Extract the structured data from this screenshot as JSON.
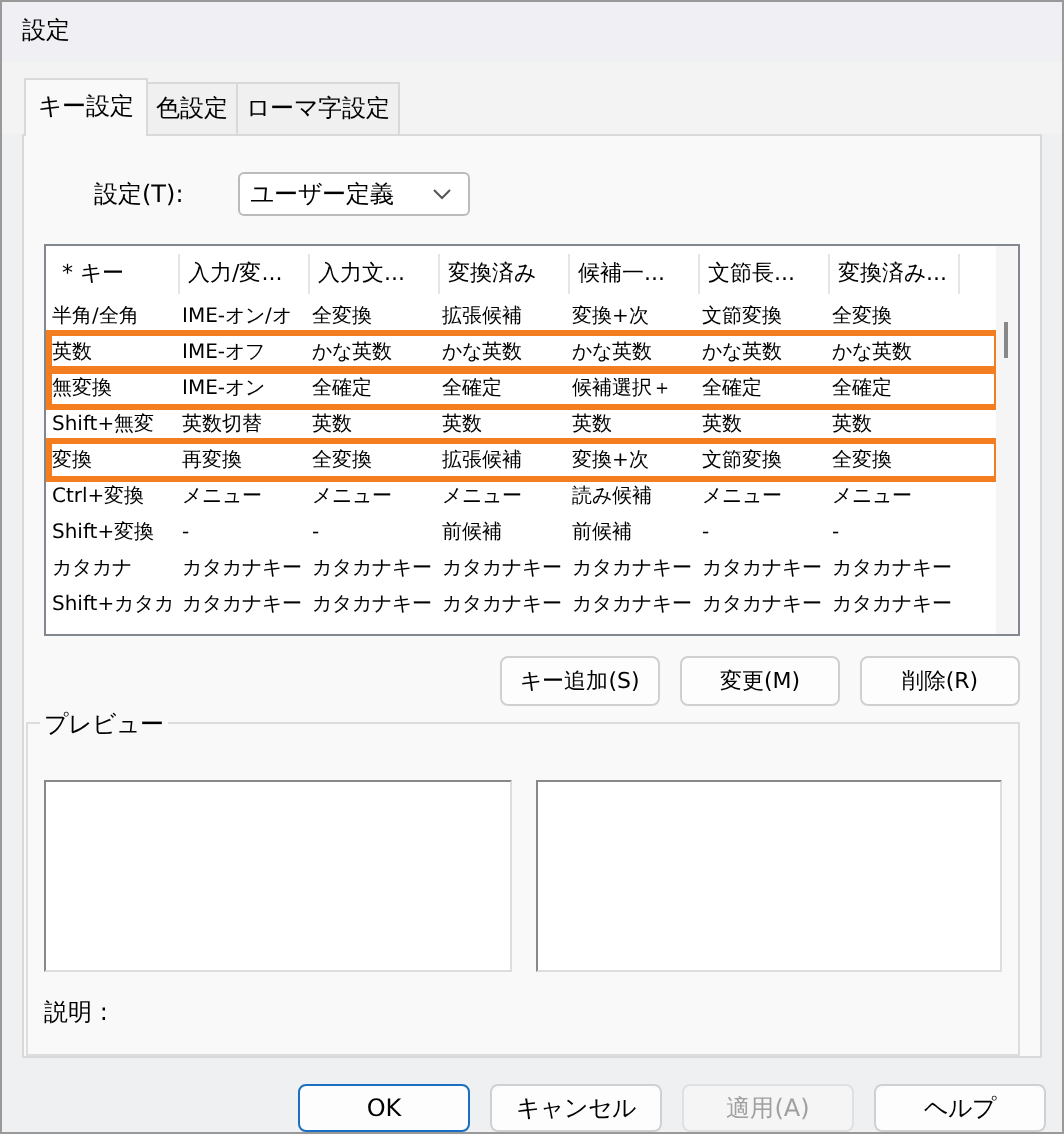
{
  "window": {
    "title": "設定"
  },
  "tabs": [
    {
      "label": "キー設定",
      "selected": true
    },
    {
      "label": "色設定",
      "selected": false
    },
    {
      "label": "ローマ字設定",
      "selected": false
    }
  ],
  "setting": {
    "label": "設定(T):",
    "value": "ユーザー定義"
  },
  "table": {
    "columns": [
      "* キー",
      "入力/変...",
      "入力文...",
      "変換済み",
      "候補一...",
      "文節長...",
      "変換済み..."
    ],
    "rows": [
      {
        "cells": [
          "半角/全角",
          "IME-オン/オ",
          "全変換",
          "拡張候補",
          "変換+次",
          "文節変換",
          "全変換"
        ],
        "highlighted": false
      },
      {
        "cells": [
          "英数",
          "IME-オフ",
          "かな英数",
          "かな英数",
          "かな英数",
          "かな英数",
          "かな英数"
        ],
        "highlighted": true
      },
      {
        "cells": [
          "無変換",
          "IME-オン",
          "全確定",
          "全確定",
          "候補選択＋",
          "全確定",
          "全確定"
        ],
        "highlighted": true
      },
      {
        "cells": [
          "Shift+無変",
          "英数切替",
          "英数",
          "英数",
          "英数",
          "英数",
          "英数"
        ],
        "highlighted": false
      },
      {
        "cells": [
          "変換",
          "再変換",
          "全変換",
          "拡張候補",
          "変換+次",
          "文節変換",
          "全変換"
        ],
        "highlighted": true
      },
      {
        "cells": [
          "Ctrl+変換",
          "メニュー",
          "メニュー",
          "メニュー",
          "読み候補",
          "メニュー",
          "メニュー"
        ],
        "highlighted": false
      },
      {
        "cells": [
          "Shift+変換",
          "-",
          "-",
          "前候補",
          "前候補",
          "-",
          "-"
        ],
        "highlighted": false
      },
      {
        "cells": [
          "カタカナ",
          "カタカナキー",
          "カタカナキー",
          "カタカナキー",
          "カタカナキー",
          "カタカナキー",
          "カタカナキー"
        ],
        "highlighted": false
      },
      {
        "cells": [
          "Shift+カタカ",
          "カタカナキー",
          "カタカナキー",
          "カタカナキー",
          "カタカナキー",
          "カタカナキー",
          "カタカナキー"
        ],
        "highlighted": false
      }
    ]
  },
  "table_buttons": [
    "キー追加(S)",
    "変更(M)",
    "削除(R)"
  ],
  "preview": {
    "title": "プレビュー",
    "description_label": "説明 :"
  },
  "dialog_buttons": [
    {
      "label": "OK",
      "disabled": false
    },
    {
      "label": "キャンセル",
      "disabled": false
    },
    {
      "label": "適用(A)",
      "disabled": true
    },
    {
      "label": "ヘルプ",
      "disabled": false
    }
  ]
}
